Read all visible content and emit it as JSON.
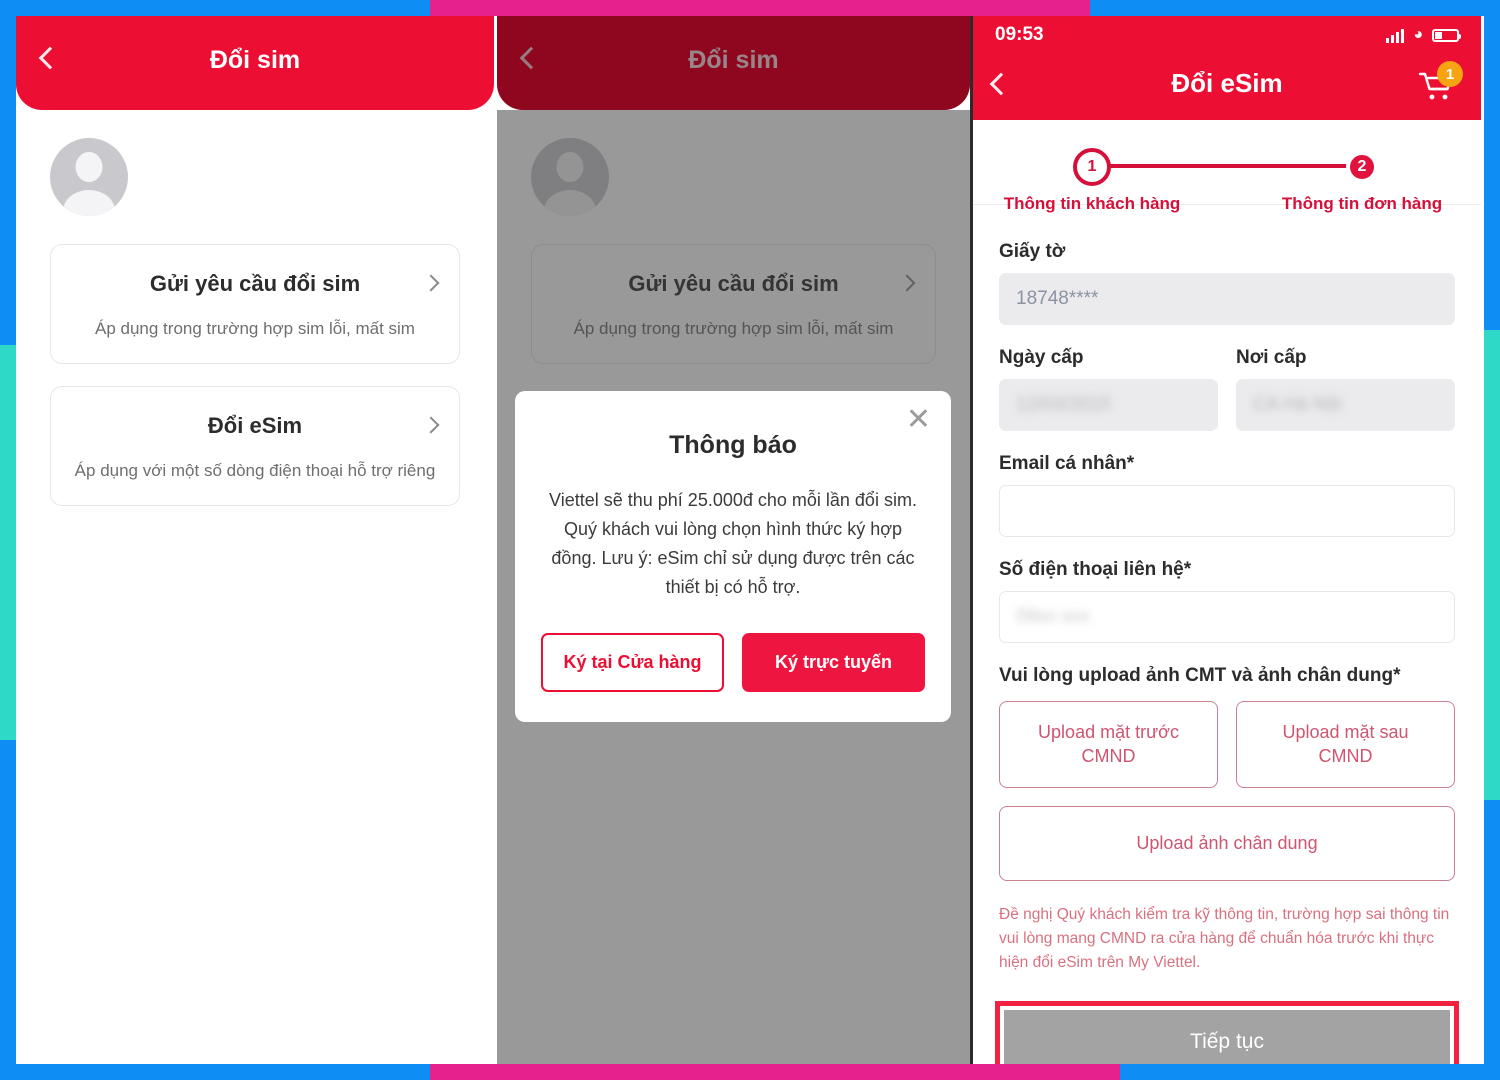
{
  "frame": {
    "accent_blue": "#0e8ef5",
    "accent_teal": "#2fd9c7",
    "accent_pink": "#e6218e",
    "brand_red": "#ed0e33"
  },
  "panel1": {
    "appbar": {
      "title": "Đổi sim",
      "back_icon": "back-chevron-icon"
    },
    "avatar": "avatar-placeholder-icon",
    "cards": [
      {
        "title": "Gửi yêu cầu đổi sim",
        "subtitle": "Áp dụng trong trường hợp sim lỗi, mất sim",
        "chevron": "chevron-right-icon"
      },
      {
        "title": "Đổi eSim",
        "subtitle": "Áp dụng với một số dòng điện thoại hỗ trợ riêng",
        "chevron": "chevron-right-icon"
      }
    ]
  },
  "panel2": {
    "appbar": {
      "title": "Đổi sim",
      "back_icon": "back-chevron-icon"
    },
    "cards": [
      {
        "title": "Gửi yêu cầu đổi sim",
        "subtitle": "Áp dụng trong trường hợp sim lỗi, mất sim",
        "chevron": "chevron-right-icon"
      }
    ],
    "modal": {
      "close_icon": "close-icon",
      "title": "Thông báo",
      "body": "Viettel sẽ thu phí 25.000đ cho mỗi lần đổi sim. Quý khách vui lòng chọn hình thức ký hợp đồng. Lưu ý: eSim chỉ sử dụng được trên các thiết bị có hỗ trợ.",
      "secondary_button": "Ký tại Cửa hàng",
      "primary_button": "Ký trực tuyến"
    }
  },
  "panel3": {
    "statusbar": {
      "time": "09:53",
      "signal_icon": "signal-bars-icon",
      "wifi_icon": "wifi-icon",
      "battery_icon": "battery-low-icon"
    },
    "appbar": {
      "title": "Đổi eSim",
      "back_icon": "back-chevron-icon",
      "cart_icon": "shopping-cart-icon",
      "cart_badge": "1"
    },
    "steps": [
      {
        "number": "1",
        "label": "Thông tin khách hàng",
        "state": "active"
      },
      {
        "number": "2",
        "label": "Thông tin đơn hàng",
        "state": "next"
      }
    ],
    "form": {
      "giay_to_label": "Giấy tờ",
      "giay_to_value": "18748****",
      "ngay_cap_label": "Ngày cấp",
      "ngay_cap_value": "",
      "noi_cap_label": "Nơi cấp",
      "noi_cap_value": "",
      "email_label": "Email cá nhân*",
      "email_value": "",
      "phone_label": "Số điện thoại liên hệ*",
      "phone_value": "",
      "upload_section_label": "Vui lòng upload ảnh CMT và ảnh chân dung*",
      "upload_front": "Upload mặt trước\nCMND",
      "upload_front_line1": "Upload mặt trước",
      "upload_front_line2": "CMND",
      "upload_back_line1": "Upload mặt sau",
      "upload_back_line2": "CMND",
      "upload_portrait": "Upload ảnh chân dung",
      "note": "Đề nghị Quý khách kiểm tra kỹ thông tin, trường hợp sai thông tin vui lòng mang CMND ra cửa hàng để chuẩn hóa trước khi thực hiện đổi eSim trên My Viettel.",
      "cta_label": "Tiếp tục"
    }
  }
}
